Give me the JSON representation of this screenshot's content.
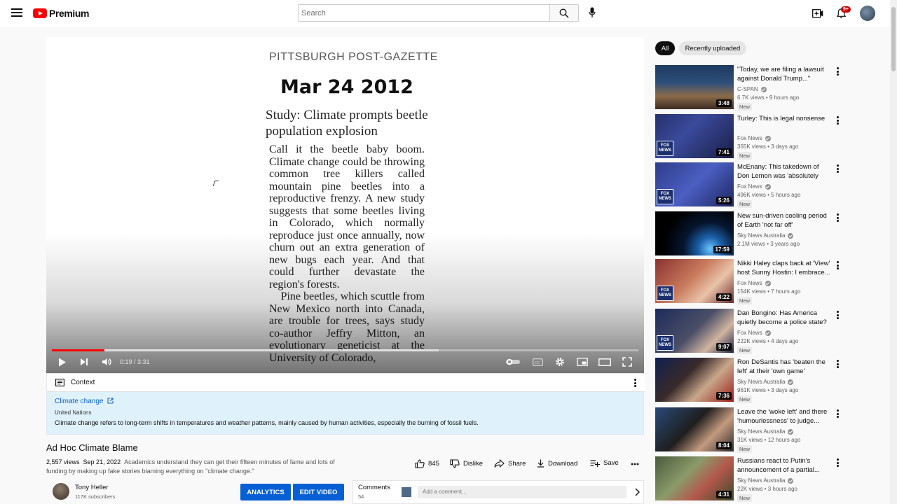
{
  "header": {
    "logo_text": "Premium",
    "search_placeholder": "Search",
    "notification_count": "9+",
    "icons": [
      "menu-icon",
      "search-icon",
      "mic-icon",
      "create-icon",
      "bell-icon"
    ]
  },
  "player": {
    "frame": {
      "newspaper": "PITTSBURGH POST-GAZETTE",
      "date": "Mar 24 2012",
      "headline": "Study: Climate prompts beetle population explosion",
      "body": "Call it the beetle baby boom. Climate change could be throwing common tree killers called mountain pine beetles into a reproductive frenzy. A new study suggests that some beetles living in Colorado, which normally reproduce just once annually, now churn out an extra generation of new bugs each year. And that could further devastate the region's forests.\n    Pine beetles, which scuttle from New Mexico north into Canada, are trouble for trees, says study co-author Jeffry Mitton, an evolutionary geneticist at the University of Colorado,"
    },
    "time": "0:19 / 3:31",
    "progress_played": 0.09,
    "progress_buffered": 0.66,
    "accent_color": "#ff0000"
  },
  "context": {
    "label": "Context",
    "topic": "Climate change",
    "source": "United Nations",
    "description": "Climate change refers to long-term shifts in temperatures and weather patterns, mainly caused by human activities, especially the burning of fossil fuels."
  },
  "video": {
    "title": "Ad Hoc Climate Blame",
    "views": "2,557 views",
    "date": "Sep 21, 2022",
    "description": "Academics understand they can get their fifteen minutes of fame and lots of funding by making up fake stories blaming everything on \"climate change.\"",
    "like_count": "845",
    "dislike_label": "Dislike",
    "share_label": "Share",
    "download_label": "Download",
    "save_label": "Save"
  },
  "channel": {
    "name": "Tony Heller",
    "subscribers": "117K subscribers",
    "analytics_label": "ANALYTICS",
    "edit_label": "EDIT VIDEO"
  },
  "comments": {
    "label": "Comments",
    "count": "54",
    "placeholder": "Add a comment..."
  },
  "chips": {
    "all": "All",
    "recent": "Recently uploaded"
  },
  "recommendations": [
    {
      "title": "\"Today, we are filing a lawsuit against Donald Trump...\"",
      "channel": "C-SPAN",
      "stats": "6.7K views • 9 hours ago",
      "badge": "New",
      "duration": "3:48"
    },
    {
      "title": "Turley: This is legal nonsense",
      "channel": "Fox News",
      "stats": "355K views • 3 days ago",
      "badge": "New",
      "duration": "7:41"
    },
    {
      "title": "McEnany: This takedown of Don Lemon was 'absolutely epic'",
      "channel": "Fox News",
      "stats": "496K views • 5 hours ago",
      "badge": "New",
      "duration": "5:26"
    },
    {
      "title": "New sun-driven cooling period of Earth 'not far off'",
      "channel": "Sky News Australia",
      "stats": "2.1M views • 3 years ago",
      "badge": "",
      "duration": "17:59"
    },
    {
      "title": "Nikki Haley claps back at 'View' host Sunny Hostin: I embrace...",
      "channel": "Fox News",
      "stats": "154K views • 7 hours ago",
      "badge": "New",
      "duration": "4:22"
    },
    {
      "title": "Dan Bongino: Has America quietly become a police state?",
      "channel": "Fox News",
      "stats": "222K views • 4 days ago",
      "badge": "New",
      "duration": "9:07"
    },
    {
      "title": "Ron DeSantis has 'beaten the left' at their 'own game'",
      "channel": "Sky News Australia",
      "stats": "961K views • 3 days ago",
      "badge": "New",
      "duration": "7:36"
    },
    {
      "title": "Leave the 'woke left' and there 'humourlessness' to judge...",
      "channel": "Sky News Australia",
      "stats": "31K views • 12 hours ago",
      "badge": "New",
      "duration": "8:04"
    },
    {
      "title": "Russians react to Putin's announcement of a partial...",
      "channel": "Sky News Australia",
      "stats": "22K views • 3 hours ago",
      "badge": "New",
      "duration": "4:31"
    }
  ]
}
